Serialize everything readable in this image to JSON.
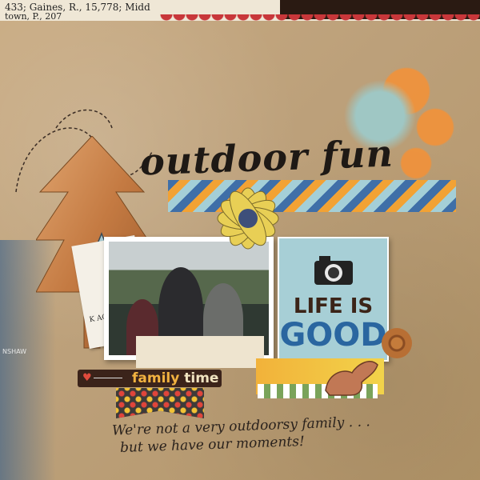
{
  "top_strip": {
    "line1": "433; Gaines, R., 15,778; Midd",
    "line2": "town, P., 207"
  },
  "title": "outdoor fun",
  "label": {
    "prefix": "family",
    "suffix": "time"
  },
  "card": {
    "line1": "LIFE IS",
    "line2": "GOOD"
  },
  "journaling": {
    "line1": "We're not a very outdoorsy family . . .",
    "line2": "but we have our moments!"
  },
  "ticket_text": "K ACRES",
  "edge_stamp": "NSHAW",
  "icons": {
    "tree": "wood-tree-icon",
    "star": "star-icon",
    "flower": "flower-icon",
    "camera": "camera-icon",
    "squirrel": "squirrel-icon",
    "heart": "heart-icon"
  },
  "colors": {
    "background": "#bca07a",
    "card_blue": "#a7cfd6",
    "good_blue": "#2a66a0",
    "label_dark": "#3b231a",
    "accent_orange": "#f2923a",
    "scallop_red": "#c8373a"
  }
}
